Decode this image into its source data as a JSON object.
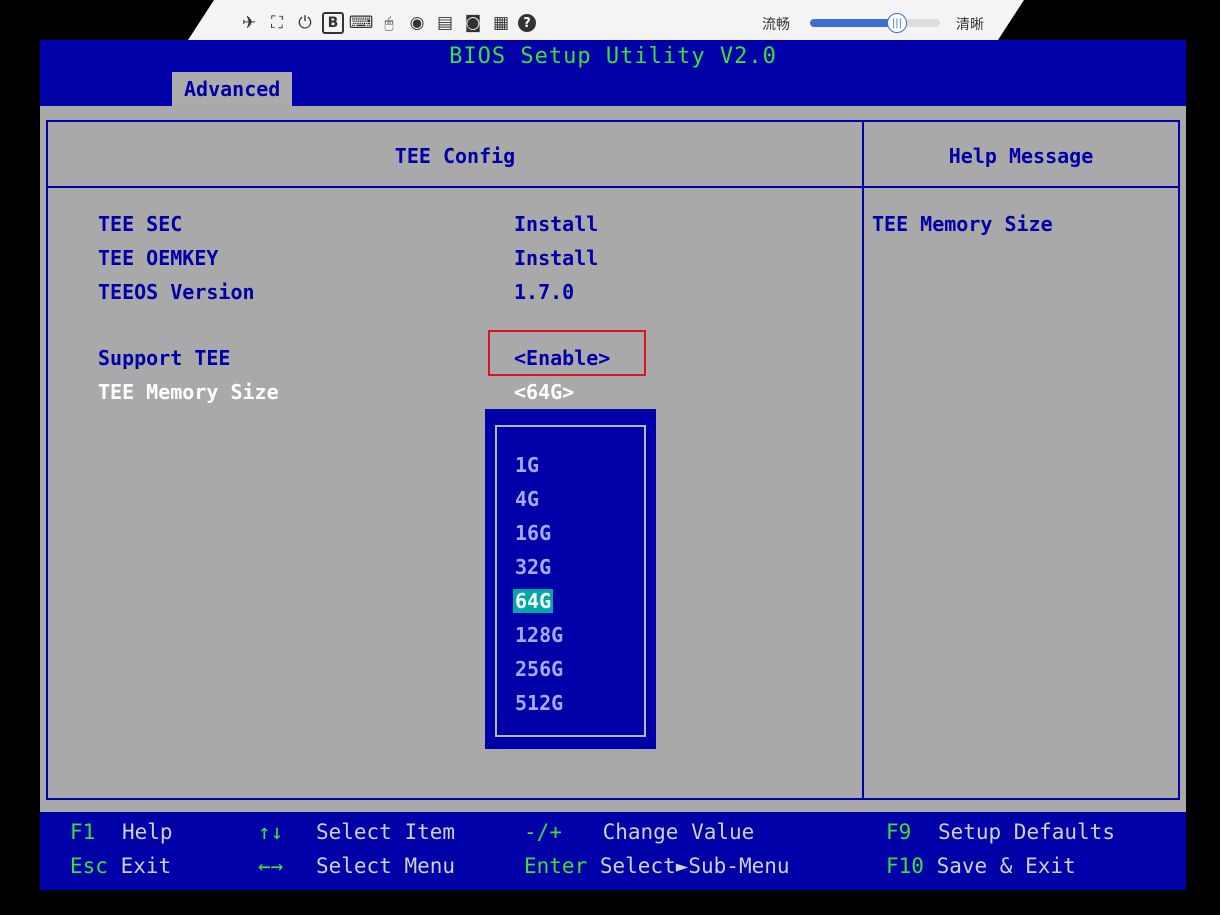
{
  "kvm_toolbar": {
    "icons": [
      {
        "name": "pin-icon",
        "glyph": "✈"
      },
      {
        "name": "fullscreen-icon",
        "glyph": "⛶"
      },
      {
        "name": "power-icon",
        "glyph": "⏻"
      },
      {
        "name": "boot-icon",
        "glyph": "B"
      },
      {
        "name": "keyboard-icon",
        "glyph": "⌨"
      },
      {
        "name": "mouse-icon",
        "glyph": "🖱"
      },
      {
        "name": "disc-icon",
        "glyph": "◉"
      },
      {
        "name": "record-icon",
        "glyph": "▤"
      },
      {
        "name": "video-icon",
        "glyph": "◙"
      },
      {
        "name": "screenshot-icon",
        "glyph": "▦"
      },
      {
        "name": "help-icon",
        "glyph": "?"
      }
    ],
    "quality_left_label": "流畅",
    "quality_right_label": "清晰",
    "quality_level": 0.7,
    "accent_color": "#3b6fd4"
  },
  "header": {
    "title": "BIOS Setup Utility V2.0",
    "active_tab": "Advanced"
  },
  "main": {
    "panel_title": "TEE Config",
    "rows": [
      {
        "label": "TEE SEC",
        "value": "Install"
      },
      {
        "label": "TEE OEMKEY",
        "value": "Install"
      },
      {
        "label": "TEEOS Version",
        "value": "1.7.0"
      },
      {
        "label": "Support TEE",
        "value": "<Enable>"
      },
      {
        "label": "TEE Memory Size",
        "value": "<64G>"
      }
    ]
  },
  "popup": {
    "options": [
      "1G",
      "4G",
      "16G",
      "32G",
      "64G",
      "128G",
      "256G",
      "512G"
    ],
    "selected": "64G"
  },
  "help": {
    "title": "Help Message",
    "text": "TEE Memory Size"
  },
  "footer": {
    "keys": [
      {
        "key": "F1",
        "desc": "Help"
      },
      {
        "key": "Esc",
        "desc": "Exit"
      },
      {
        "key": "↑↓",
        "desc": "Select Item"
      },
      {
        "key": "←→",
        "desc": "Select Menu"
      },
      {
        "key": "-/+",
        "desc": "Change Value"
      },
      {
        "key": "Enter",
        "desc": "Select►Sub-Menu"
      },
      {
        "key": "F9",
        "desc": "Setup Defaults"
      },
      {
        "key": "F10",
        "desc": "Save & Exit"
      }
    ]
  },
  "colors": {
    "bios_blue": "#0000a8",
    "bios_gray": "#a9a9a9",
    "title_green": "#38e03a",
    "highlight_red": "#e0141e",
    "selected_cyan": "#00a8a8"
  }
}
